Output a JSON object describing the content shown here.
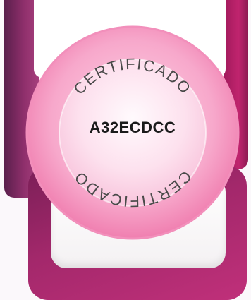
{
  "seal": {
    "top_text": "CERTIFICADO",
    "bottom_text": "CERTIFICADO",
    "code": "A32ECDCC",
    "colors": {
      "rim": "#f7a8cb",
      "face": "#fde1ee",
      "frame": "#8e2f6b",
      "card": "#b02a70"
    }
  }
}
